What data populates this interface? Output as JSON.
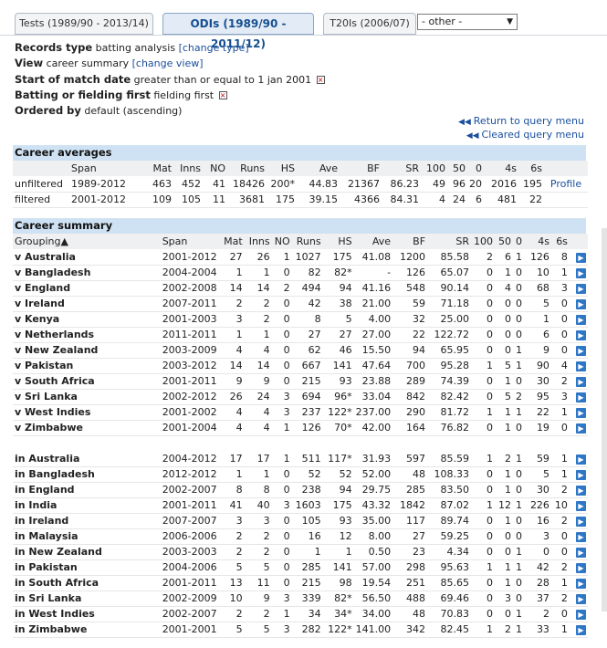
{
  "tabs": [
    {
      "label": "Tests (1989/90 - 2013/14)",
      "active": false
    },
    {
      "label": "ODIs (1989/90 - 2011/12)",
      "active": true
    },
    {
      "label": "T20Is (2006/07)",
      "active": false
    }
  ],
  "other_select": {
    "value": "- other -"
  },
  "query": {
    "records_type_label": "Records type",
    "records_type_value": "batting analysis",
    "records_type_link": "[change type]",
    "view_label": "View",
    "view_value": "career summary",
    "view_link": "[change view]",
    "start_date_label": "Start of match date",
    "start_date_value": "greater than or equal to 1 jan 2001",
    "bat_field_label": "Batting or fielding first",
    "bat_field_value": "fielding first",
    "ordered_label": "Ordered by",
    "ordered_value": "default (ascending)"
  },
  "links": {
    "return": "Return to query menu",
    "cleared": "Cleared query menu"
  },
  "career_averages": {
    "title": "Career averages",
    "headers": [
      "",
      "Span",
      "Mat",
      "Inns",
      "NO",
      "Runs",
      "HS",
      "Ave",
      "BF",
      "SR",
      "100",
      "50",
      "0",
      "4s",
      "6s",
      ""
    ],
    "rows": [
      [
        "unfiltered",
        "1989-2012",
        "463",
        "452",
        "41",
        "18426",
        "200*",
        "44.83",
        "21367",
        "86.23",
        "49",
        "96",
        "20",
        "2016",
        "195",
        "Profile"
      ],
      [
        "filtered",
        "2001-2012",
        "109",
        "105",
        "11",
        "3681",
        "175",
        "39.15",
        "4366",
        "84.31",
        "4",
        "24",
        "6",
        "481",
        "22",
        ""
      ]
    ]
  },
  "career_summary": {
    "title": "Career summary",
    "headers": [
      "Grouping",
      "Span",
      "Mat",
      "Inns",
      "NO",
      "Runs",
      "HS",
      "Ave",
      "BF",
      "SR",
      "100",
      "50",
      "0",
      "4s",
      "6s",
      ""
    ],
    "sort_indicator": "▲",
    "rows_vs": [
      [
        "v Australia",
        "2001-2012",
        "27",
        "26",
        "1",
        "1027",
        "175",
        "41.08",
        "1200",
        "85.58",
        "2",
        "6",
        "1",
        "126",
        "8"
      ],
      [
        "v Bangladesh",
        "2004-2004",
        "1",
        "1",
        "0",
        "82",
        "82*",
        "-",
        "126",
        "65.07",
        "0",
        "1",
        "0",
        "10",
        "1"
      ],
      [
        "v England",
        "2002-2008",
        "14",
        "14",
        "2",
        "494",
        "94",
        "41.16",
        "548",
        "90.14",
        "0",
        "4",
        "0",
        "68",
        "3"
      ],
      [
        "v Ireland",
        "2007-2011",
        "2",
        "2",
        "0",
        "42",
        "38",
        "21.00",
        "59",
        "71.18",
        "0",
        "0",
        "0",
        "5",
        "0"
      ],
      [
        "v Kenya",
        "2001-2003",
        "3",
        "2",
        "0",
        "8",
        "5",
        "4.00",
        "32",
        "25.00",
        "0",
        "0",
        "0",
        "1",
        "0"
      ],
      [
        "v Netherlands",
        "2011-2011",
        "1",
        "1",
        "0",
        "27",
        "27",
        "27.00",
        "22",
        "122.72",
        "0",
        "0",
        "0",
        "6",
        "0"
      ],
      [
        "v New Zealand",
        "2003-2009",
        "4",
        "4",
        "0",
        "62",
        "46",
        "15.50",
        "94",
        "65.95",
        "0",
        "0",
        "1",
        "9",
        "0"
      ],
      [
        "v Pakistan",
        "2003-2012",
        "14",
        "14",
        "0",
        "667",
        "141",
        "47.64",
        "700",
        "95.28",
        "1",
        "5",
        "1",
        "90",
        "4"
      ],
      [
        "v South Africa",
        "2001-2011",
        "9",
        "9",
        "0",
        "215",
        "93",
        "23.88",
        "289",
        "74.39",
        "0",
        "1",
        "0",
        "30",
        "2"
      ],
      [
        "v Sri Lanka",
        "2002-2012",
        "26",
        "24",
        "3",
        "694",
        "96*",
        "33.04",
        "842",
        "82.42",
        "0",
        "5",
        "2",
        "95",
        "3"
      ],
      [
        "v West Indies",
        "2001-2002",
        "4",
        "4",
        "3",
        "237",
        "122*",
        "237.00",
        "290",
        "81.72",
        "1",
        "1",
        "1",
        "22",
        "1"
      ],
      [
        "v Zimbabwe",
        "2001-2004",
        "4",
        "4",
        "1",
        "126",
        "70*",
        "42.00",
        "164",
        "76.82",
        "0",
        "1",
        "0",
        "19",
        "0"
      ]
    ],
    "rows_in": [
      [
        "in Australia",
        "2004-2012",
        "17",
        "17",
        "1",
        "511",
        "117*",
        "31.93",
        "597",
        "85.59",
        "1",
        "2",
        "1",
        "59",
        "1"
      ],
      [
        "in Bangladesh",
        "2012-2012",
        "1",
        "1",
        "0",
        "52",
        "52",
        "52.00",
        "48",
        "108.33",
        "0",
        "1",
        "0",
        "5",
        "1"
      ],
      [
        "in England",
        "2002-2007",
        "8",
        "8",
        "0",
        "238",
        "94",
        "29.75",
        "285",
        "83.50",
        "0",
        "1",
        "0",
        "30",
        "2"
      ],
      [
        "in India",
        "2001-2011",
        "41",
        "40",
        "3",
        "1603",
        "175",
        "43.32",
        "1842",
        "87.02",
        "1",
        "12",
        "1",
        "226",
        "10"
      ],
      [
        "in Ireland",
        "2007-2007",
        "3",
        "3",
        "0",
        "105",
        "93",
        "35.00",
        "117",
        "89.74",
        "0",
        "1",
        "0",
        "16",
        "2"
      ],
      [
        "in Malaysia",
        "2006-2006",
        "2",
        "2",
        "0",
        "16",
        "12",
        "8.00",
        "27",
        "59.25",
        "0",
        "0",
        "0",
        "3",
        "0"
      ],
      [
        "in New Zealand",
        "2003-2003",
        "2",
        "2",
        "0",
        "1",
        "1",
        "0.50",
        "23",
        "4.34",
        "0",
        "0",
        "1",
        "0",
        "0"
      ],
      [
        "in Pakistan",
        "2004-2006",
        "5",
        "5",
        "0",
        "285",
        "141",
        "57.00",
        "298",
        "95.63",
        "1",
        "1",
        "1",
        "42",
        "2"
      ],
      [
        "in South Africa",
        "2001-2011",
        "13",
        "11",
        "0",
        "215",
        "98",
        "19.54",
        "251",
        "85.65",
        "0",
        "1",
        "0",
        "28",
        "1"
      ],
      [
        "in Sri Lanka",
        "2002-2009",
        "10",
        "9",
        "3",
        "339",
        "82*",
        "56.50",
        "488",
        "69.46",
        "0",
        "3",
        "0",
        "37",
        "2"
      ],
      [
        "in West Indies",
        "2002-2007",
        "2",
        "2",
        "1",
        "34",
        "34*",
        "34.00",
        "48",
        "70.83",
        "0",
        "0",
        "1",
        "2",
        "0"
      ],
      [
        "in Zimbabwe",
        "2001-2001",
        "5",
        "5",
        "3",
        "282",
        "122*",
        "141.00",
        "342",
        "82.45",
        "1",
        "2",
        "1",
        "33",
        "1"
      ]
    ]
  }
}
